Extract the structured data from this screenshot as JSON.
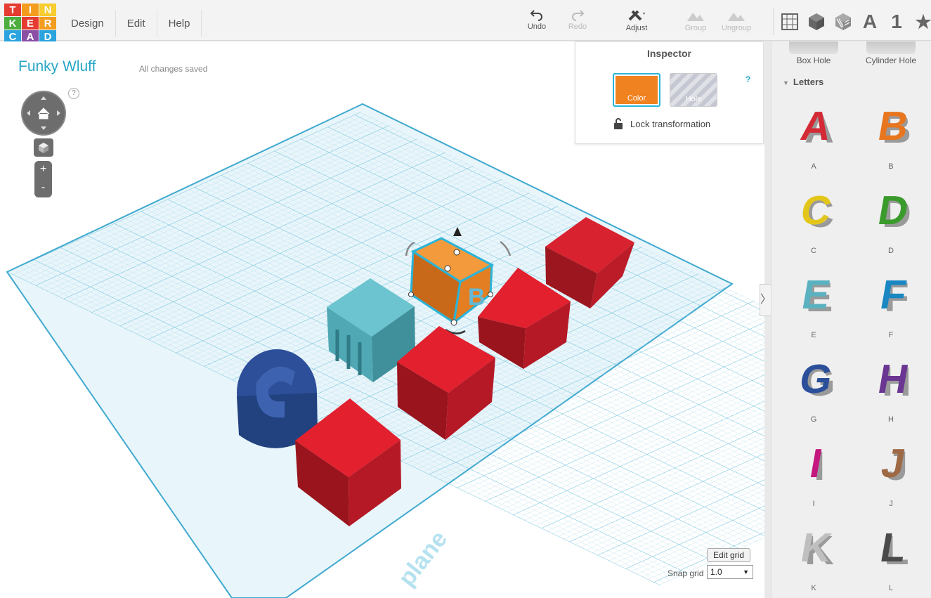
{
  "app": {
    "logo_letters": [
      "T",
      "I",
      "N",
      "K",
      "E",
      "R",
      "C",
      "A",
      "D"
    ],
    "logo_colors": [
      "#e53b31",
      "#f49c1d",
      "#f6cc2f",
      "#4dad3f",
      "#e53b31",
      "#f49c1d",
      "#2aa3de",
      "#8b50a5",
      "#2aa3de"
    ]
  },
  "menu": {
    "items": [
      "Design",
      "Edit",
      "Help"
    ]
  },
  "toolbar": {
    "undo": "Undo",
    "redo": "Redo",
    "adjust": "Adjust",
    "group": "Group",
    "ungroup": "Ungroup"
  },
  "shape_tabs": {
    "grid_icon": "grid-icon",
    "solid_icon": "cube-icon",
    "hole_icon": "hole-cube-icon",
    "letters": "A",
    "numbers": "1",
    "favorites_icon": "star-icon"
  },
  "project": {
    "title": "Funky Wluff",
    "status": "All changes saved"
  },
  "view_controls": {
    "help": "?",
    "zoom_in": "+",
    "zoom_out": "-"
  },
  "workplane": {
    "label": "plane",
    "edit_grid": "Edit grid",
    "snap_label": "Snap grid",
    "snap_value": "1.0"
  },
  "inspector": {
    "title": "Inspector",
    "color_label": "Color",
    "hole_label": "Hole",
    "help": "?",
    "lock_label": "Lock transformation",
    "color_hex": "#f0821f"
  },
  "panel": {
    "holes": [
      "Box Hole",
      "Cylinder Hole"
    ],
    "category": "Letters",
    "letters": [
      {
        "label": "A",
        "color": "#d42a35"
      },
      {
        "label": "B",
        "color": "#e8761f"
      },
      {
        "label": "C",
        "color": "#e3c61b"
      },
      {
        "label": "D",
        "color": "#3a9b2c"
      },
      {
        "label": "E",
        "color": "#5ab1bf"
      },
      {
        "label": "F",
        "color": "#1a87c2"
      },
      {
        "label": "G",
        "color": "#2c4f9a"
      },
      {
        "label": "H",
        "color": "#6b3592"
      },
      {
        "label": "I",
        "color": "#c4177f"
      },
      {
        "label": "J",
        "color": "#9e6a45"
      },
      {
        "label": "K",
        "color": "#bfbfbf"
      },
      {
        "label": "L",
        "color": "#4a4a4a"
      }
    ]
  }
}
